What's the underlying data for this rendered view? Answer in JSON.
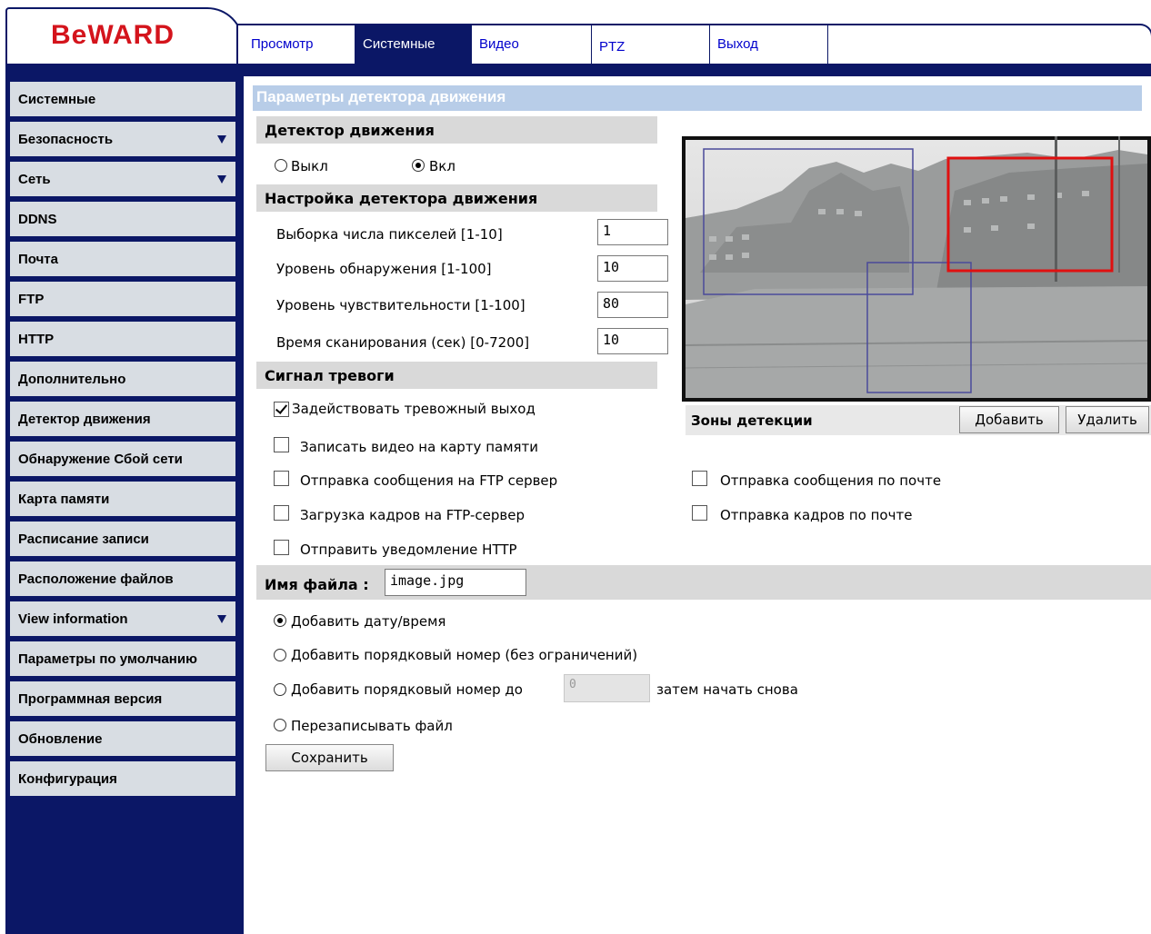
{
  "brand": {
    "logo_text": "BeWARD",
    "logo_color": "#d4141c",
    "navy": "#0b1766"
  },
  "topnav": {
    "tabs": [
      {
        "label": "Просмотр"
      },
      {
        "label": "Системные",
        "active": true
      },
      {
        "label": "Видео"
      },
      {
        "label": "PTZ"
      },
      {
        "label": "Выход"
      }
    ]
  },
  "sidebar": {
    "items": [
      {
        "label": "Системные"
      },
      {
        "label": "Безопасность",
        "has_submenu": true
      },
      {
        "label": "Сеть",
        "has_submenu": true
      },
      {
        "label": "DDNS"
      },
      {
        "label": "Почта"
      },
      {
        "label": "FTP"
      },
      {
        "label": "HTTP"
      },
      {
        "label": "Дополнительно"
      },
      {
        "label": "Детектор движения"
      },
      {
        "label": "Обнаружение Сбой сети"
      },
      {
        "label": "Карта памяти"
      },
      {
        "label": "Расписание записи"
      },
      {
        "label": "Расположение файлов"
      },
      {
        "label": "View information",
        "has_submenu": true
      },
      {
        "label": "Параметры по умолчанию"
      },
      {
        "label": "Программная версия"
      },
      {
        "label": "Обновление"
      },
      {
        "label": "Конфигурация"
      }
    ]
  },
  "main": {
    "title": "Параметры детектора движения",
    "detector": {
      "header": "Детектор движения",
      "off_label": "Выкл",
      "on_label": "Вкл",
      "enabled": true
    },
    "settings": {
      "header": "Настройка детектора движения",
      "fields": [
        {
          "label": "Выборка числа пикселей [1-10]",
          "value": "1"
        },
        {
          "label": "Уровень обнаружения [1-100]",
          "value": "10"
        },
        {
          "label": "Уровень чувствительности [1-100]",
          "value": "80"
        },
        {
          "label": "Время сканирования (сек) [0-7200]",
          "value": "10"
        }
      ]
    },
    "alarm": {
      "header": "Сигнал тревоги",
      "options": [
        {
          "label": "Задействовать тревожный выход",
          "checked": true
        },
        {
          "label": "Записать видео на карту памяти",
          "checked": false
        },
        {
          "label": "Отправка сообщения на FTP сервер",
          "checked": false
        },
        {
          "label": "Загрузка кадров на FTP-сервер",
          "checked": false
        },
        {
          "label": "Отправить уведомление HTTP",
          "checked": false
        },
        {
          "label": "Отправка сообщения по почте",
          "checked": false
        },
        {
          "label": "Отправка кадров по почте",
          "checked": false
        }
      ]
    },
    "filename": {
      "label": "Имя файла :",
      "value": "image.jpg",
      "options": [
        {
          "label": "Добавить дату/время",
          "selected": true
        },
        {
          "label": "Добавить порядковый номер (без ограничений)",
          "selected": false
        },
        {
          "label": "Добавить порядковый номер до",
          "selected": false
        },
        {
          "label": "Перезаписывать файл",
          "selected": false
        }
      ],
      "counter_value": "0",
      "counter_suffix": "затем начать снова"
    },
    "save_label": "Сохранить",
    "zones": {
      "label": "Зоны детекции",
      "add_label": "Добавить",
      "delete_label": "Удалить"
    }
  }
}
